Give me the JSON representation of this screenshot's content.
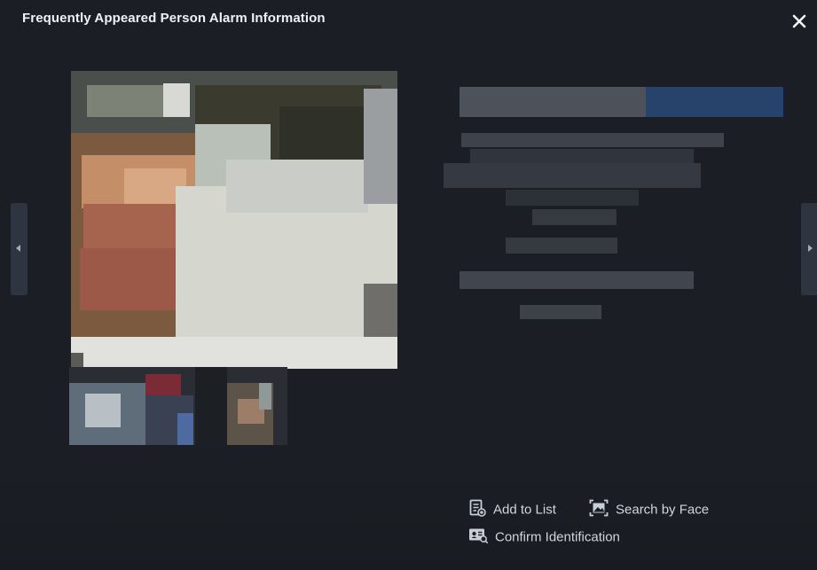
{
  "dialog": {
    "title": "Frequently Appeared Person Alarm Information",
    "close_icon": "close-icon"
  },
  "navigation": {
    "prev_icon": "chevron-left-icon",
    "next_icon": "chevron-right-icon"
  },
  "actions": {
    "add_to_list": "Add to List",
    "search_by_face": "Search by Face",
    "confirm_identification": "Confirm Identification"
  },
  "icons": {
    "add_to_list": "list-add-icon",
    "search_by_face": "face-search-icon",
    "confirm_identification": "id-card-icon"
  },
  "colors": {
    "background": "#1b1f25",
    "title_text": "#eef1f5",
    "action_text": "#cfd6df",
    "icon": "#c6ced8",
    "nav_handle": "#2e3440",
    "blurred_highlight": "#27436b"
  }
}
